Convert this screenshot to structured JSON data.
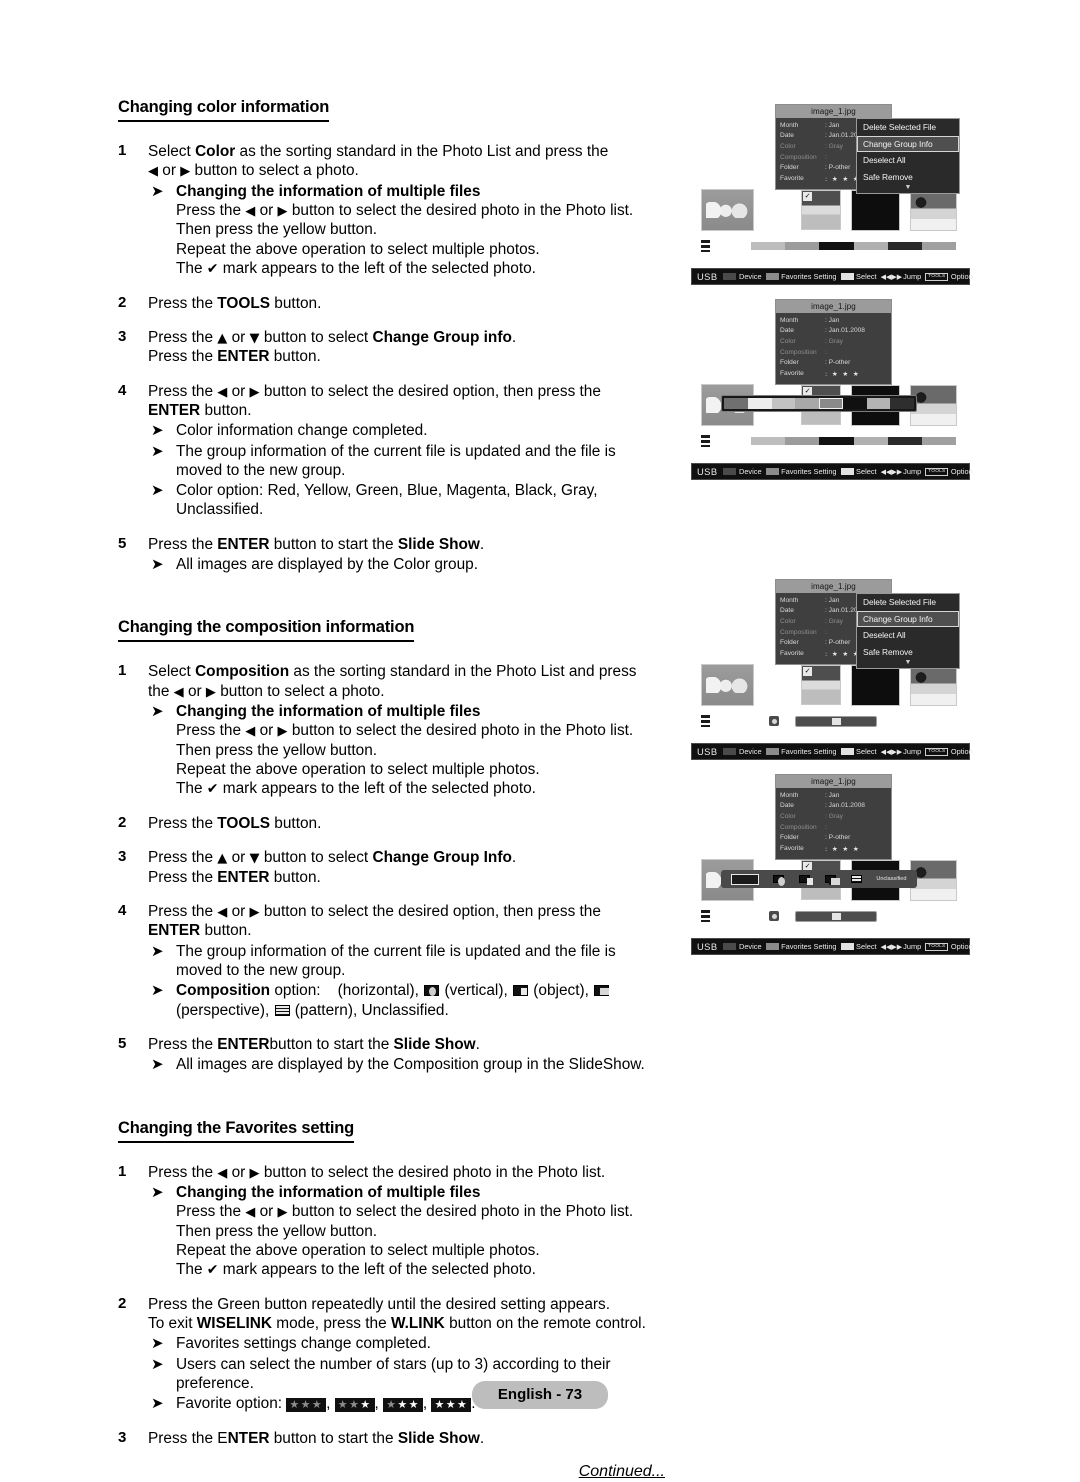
{
  "document": {
    "page_label": "English - 73",
    "continued_label": "Continued..."
  },
  "sections": [
    {
      "heading": "Changing color information",
      "steps": [
        {
          "num": "1",
          "lines": [
            "Select <b>Color</b> as the sorting standard in the Photo List and press the",
            "<span class=\"tri\">◀</span> or <span class=\"tri\">▶</span> button to select a photo."
          ],
          "subs": [
            {
              "bold_title": "Changing the information of multiple files",
              "lines": [
                "Press the <span class=\"tri\">◀</span> or <span class=\"tri\">▶</span> button to select the desired photo in the Photo list.",
                "Then press the yellow button.",
                "Repeat the above operation to select multiple photos.",
                "The <span class=\"chk\">✔</span> mark appears to the left of the selected photo."
              ]
            }
          ]
        },
        {
          "num": "2",
          "lines": [
            "Press the <b>TOOLS</b> button."
          ],
          "subs": []
        },
        {
          "num": "3",
          "lines": [
            "Press the <span class=\"tri\">▲</span> or <span class=\"tri\">▼</span> button to select <b>Change Group info</b>.",
            "Press the <b>ENTER</b> button."
          ],
          "subs": []
        },
        {
          "num": "4",
          "lines": [
            "Press the <span class=\"tri\">◀</span> or <span class=\"tri\">▶</span> button to select the desired option, then press the",
            "<b>ENTER</b> button."
          ],
          "subs": [
            {
              "bold_title": "",
              "lines": [
                "Color information change completed."
              ]
            },
            {
              "bold_title": "",
              "lines": [
                "The group information of the current file is updated and the file is",
                "moved to the new group."
              ]
            },
            {
              "bold_title": "",
              "lines": [
                "Color option: Red, Yellow, Green, Blue, Magenta, Black, Gray,",
                "Unclassified."
              ]
            }
          ]
        },
        {
          "num": "5",
          "lines": [
            "Press the <b>ENTER</b> button to start the <b>Slide Show</b>."
          ],
          "subs": [
            {
              "bold_title": "",
              "lines": [
                "All images are displayed by the Color group."
              ]
            }
          ]
        }
      ]
    },
    {
      "heading": "Changing the composition information",
      "steps": [
        {
          "num": "1",
          "lines": [
            "Select <b>Composition</b> as the sorting standard in the Photo List and press",
            "the <span class=\"tri\">◀</span> or <span class=\"tri\">▶</span> button to select a photo."
          ],
          "subs": [
            {
              "bold_title": "Changing the information of multiple files",
              "lines": [
                "Press the <span class=\"tri\">◀</span> or <span class=\"tri\">▶</span> button to select the desired photo in the Photo list.",
                "Then press the yellow button.",
                "Repeat the above operation to select multiple photos.",
                "The <span class=\"chk\">✔</span> mark appears to the left of the selected photo."
              ]
            }
          ]
        },
        {
          "num": "2",
          "lines": [
            "Press the <b>TOOLS</b> button."
          ],
          "subs": []
        },
        {
          "num": "3",
          "lines": [
            "Press the <span class=\"tri\">▲</span> or <span class=\"tri\">▼</span> button to select <b>Change Group Info</b>.",
            "Press the <b>ENTER</b> button."
          ],
          "subs": []
        },
        {
          "num": "4",
          "lines": [
            "Press the <span class=\"tri\">◀</span> or <span class=\"tri\">▶</span> button to select the desired option, then press the",
            "<b>ENTER</b> button."
          ],
          "subs": [
            {
              "bold_title": "",
              "lines": [
                "The group information of the current file is updated and the file is",
                "moved to the new group."
              ]
            },
            {
              "bold_title": "",
              "lines": [
                "<b>Composition</b> option:&nbsp;&nbsp;&nbsp;&nbsp;(horizontal), <span class=\"glyph vertical\"></span> (vertical), <span class=\"glyph object\"></span> (object), <span class=\"glyph perspective\"></span>",
                "(perspective), <span class=\"glyph pattern\"></span> (pattern), Unclassified."
              ]
            }
          ]
        },
        {
          "num": "5",
          "lines": [
            "Press the <b>ENTER</b>button to start the <b>Slide Show</b>."
          ],
          "subs": [
            {
              "bold_title": "",
              "lines": [
                "All images are displayed by the Composition group in the SlideShow."
              ]
            }
          ]
        }
      ]
    },
    {
      "heading": "Changing the Favorites setting",
      "steps": [
        {
          "num": "1",
          "lines": [
            "Press the <span class=\"tri\">◀</span> or <span class=\"tri\">▶</span> button to select the desired photo in the Photo list."
          ],
          "subs": [
            {
              "bold_title": "Changing the information of multiple files",
              "lines": [
                "Press the <span class=\"tri\">◀</span> or <span class=\"tri\">▶</span> button to select the desired photo in the Photo list.",
                "Then press the yellow button.",
                "Repeat the above operation to select multiple photos.",
                "The <span class=\"chk\">✔</span> mark appears to the left of the selected photo."
              ]
            }
          ]
        },
        {
          "num": "2",
          "lines": [
            "Press the Green button repeatedly until the desired setting appears.",
            "To exit <b>WISELINK</b> mode, press the <b>W.LINK</b> button on the remote control."
          ],
          "subs": [
            {
              "bold_title": "",
              "lines": [
                "Favorites settings change completed."
              ]
            },
            {
              "bold_title": "",
              "lines": [
                "Users can select the number of stars (up to 3) according to their",
                "preference."
              ]
            },
            {
              "bold_title": "",
              "lines": [
                "Favorite option: <span class=\"favchip\"><i>★</i><i>★</i><i>★</i></span>, <span class=\"favchip\"><i>★</i><i>★</i><i class=\"on\">★</i></span>, <span class=\"favchip\"><i>★</i><i class=\"on\">★</i><i class=\"on\">★</i></span>, <span class=\"favchip\"><i class=\"on\">★</i><i class=\"on\">★</i><i class=\"on\">★</i></span>."
              ]
            }
          ]
        },
        {
          "num": "3",
          "lines": [
            "Press the E<b>NTER</b> button to start the <b>Slide Show</b>."
          ],
          "subs": []
        }
      ]
    }
  ],
  "screenshots": {
    "common": {
      "file_title": "image_1.jpg",
      "info_rows": [
        {
          "key": "Month",
          "value": ": Jan",
          "dim": false
        },
        {
          "key": "Date",
          "value": ": Jan.01.2008",
          "dim": false
        },
        {
          "key": "Color",
          "value": ": Gray",
          "dim": true
        },
        {
          "key": "Composition",
          "value": ":",
          "dim": true
        },
        {
          "key": "Folder",
          "value": ": P-other",
          "dim": false
        },
        {
          "key": "Favorite",
          "value": ": ★ ★ ★",
          "dim": false
        }
      ],
      "menu_items": [
        {
          "label": "Delete Selected File",
          "selected": false
        },
        {
          "label": "Change Group Info",
          "selected": true
        },
        {
          "label": "Deselect All",
          "selected": false
        },
        {
          "label": "Safe Remove",
          "selected": false
        }
      ],
      "menu_more": "▼",
      "status_bar": {
        "usb": "USB",
        "items": [
          {
            "label": "Device",
            "swatch": "#4a4a4a"
          },
          {
            "label": "Favorites Setting",
            "swatch": "#8b8b8b"
          },
          {
            "label": "Select",
            "swatch": "#e2e2e2"
          }
        ],
        "jump_icon": "◀◀▶▶",
        "jump_label": "Jump",
        "tools_key": "TOOLS",
        "option_label": "Option"
      },
      "composition_strip": {
        "items": [
          {
            "type": "box",
            "label": ""
          },
          {
            "type": "icon",
            "label": "vertical"
          },
          {
            "type": "icon",
            "label": "object"
          },
          {
            "type": "icon",
            "label": "perspective"
          },
          {
            "type": "icon",
            "label": "pattern"
          },
          {
            "type": "text",
            "label": "Unclassified"
          }
        ]
      },
      "color_strip": {
        "swatches": [
          "#707070",
          "#ededed",
          "#c2c2c2",
          "#a8a8a8",
          "#8a8a8a",
          "#101010",
          "#b4b4b4",
          "#2e2e2e"
        ],
        "current_index": 4
      },
      "meter_segments": [
        "#bdbdbd",
        "#9c9c9c",
        "#121212",
        "#b0b0b0",
        "#2a2a2a",
        "#a0a0a0"
      ]
    },
    "variants": [
      {
        "id": "shot-color-menu",
        "has_menu": true,
        "picker": "none",
        "bottom": "meter"
      },
      {
        "id": "shot-color-picker",
        "has_menu": false,
        "picker": "color",
        "bottom": "meter"
      },
      {
        "id": "shot-composition-menu",
        "has_menu": true,
        "picker": "none",
        "bottom": "slider"
      },
      {
        "id": "shot-composition-picker",
        "has_menu": false,
        "picker": "composition",
        "bottom": "slider"
      }
    ]
  }
}
